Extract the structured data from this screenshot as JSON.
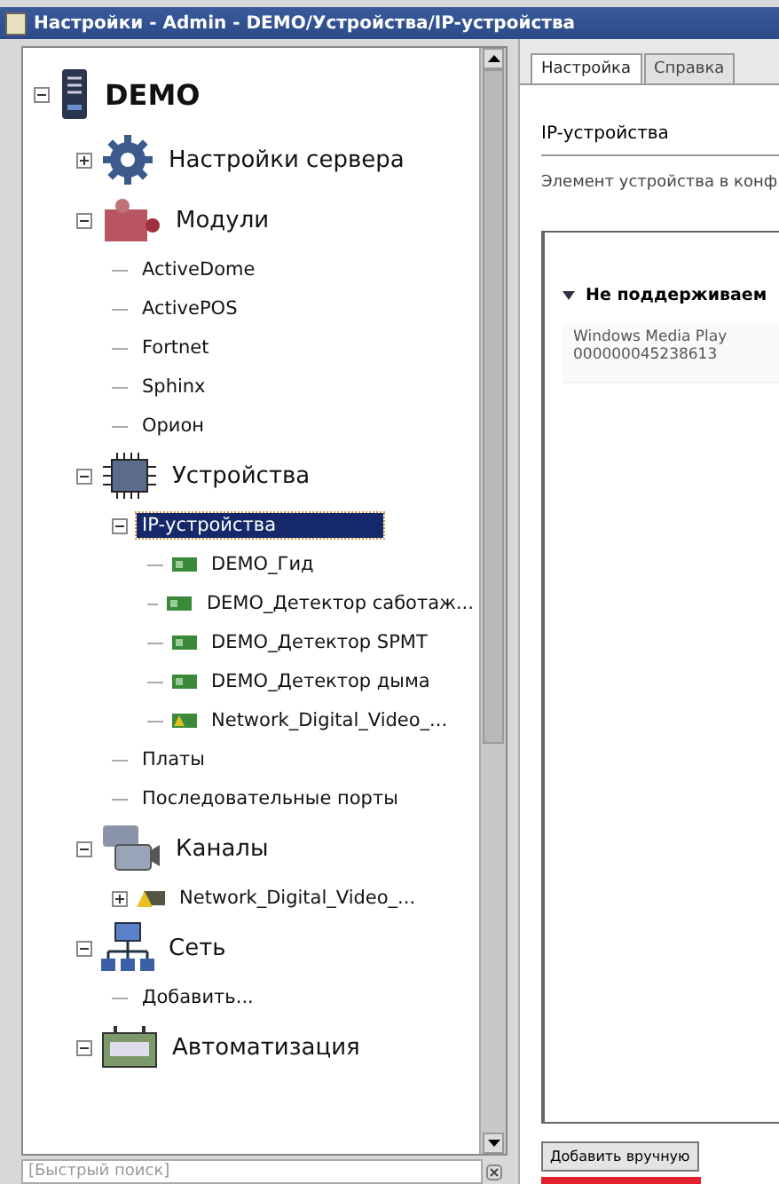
{
  "window": {
    "title": "Настройки - Admin - DEMO/Устройства/IP-устройства"
  },
  "tree": [
    {
      "label": "DEMO",
      "kind": "server",
      "expanded": true,
      "selected": false,
      "children": [
        {
          "label": "Настройки сервера",
          "kind": "gear",
          "expanded": false,
          "selected": false
        },
        {
          "label": "Модули",
          "kind": "puzzle",
          "expanded": true,
          "selected": false,
          "children": [
            {
              "label": "ActiveDome",
              "selected": false
            },
            {
              "label": "ActivePOS",
              "selected": false
            },
            {
              "label": "Fortnet",
              "selected": false
            },
            {
              "label": "Sphinx",
              "selected": false
            },
            {
              "label": "Орион",
              "selected": false
            }
          ]
        },
        {
          "label": "Устройства",
          "kind": "chip",
          "expanded": true,
          "selected": false,
          "children": [
            {
              "label": "IP-устройства",
              "expanded": true,
              "selected": true,
              "children": [
                {
                  "label": "DEMO_Гид",
                  "kind": "device",
                  "selected": false
                },
                {
                  "label": "DEMO_Детектор саботаж...",
                  "kind": "device",
                  "selected": false
                },
                {
                  "label": "DEMO_Детектор SPMT",
                  "kind": "device",
                  "selected": false
                },
                {
                  "label": "DEMO_Детектор дыма",
                  "kind": "device",
                  "selected": false
                },
                {
                  "label": "Network_Digital_Video_...",
                  "kind": "device-warn",
                  "selected": false
                }
              ]
            },
            {
              "label": "Платы",
              "selected": false
            },
            {
              "label": "Последовательные порты",
              "selected": false
            }
          ]
        },
        {
          "label": "Каналы",
          "kind": "camera",
          "expanded": true,
          "selected": false,
          "children": [
            {
              "label": "Network_Digital_Video_...",
              "kind": "warning",
              "expanded": false,
              "selected": false
            }
          ]
        },
        {
          "label": "Сеть",
          "kind": "network",
          "expanded": true,
          "selected": false,
          "children": [
            {
              "label": "Добавить...",
              "selected": false
            }
          ]
        },
        {
          "label": "Автоматизация",
          "kind": "automation",
          "expanded": true,
          "selected": false
        }
      ]
    }
  ],
  "search": {
    "placeholder": "[Быстрый поиск]"
  },
  "tabs": [
    {
      "label": "Настройка",
      "selected": true
    },
    {
      "label": "Справка",
      "selected": false
    }
  ],
  "panel": {
    "heading": "IP-устройства",
    "description": "Элемент устройства в конф",
    "group": {
      "label": "Не поддерживаем",
      "expanded": true,
      "entries": [
        {
          "name": "Windows Media Play",
          "id": "000000045238613"
        }
      ]
    },
    "button": "Добавить вручную"
  }
}
